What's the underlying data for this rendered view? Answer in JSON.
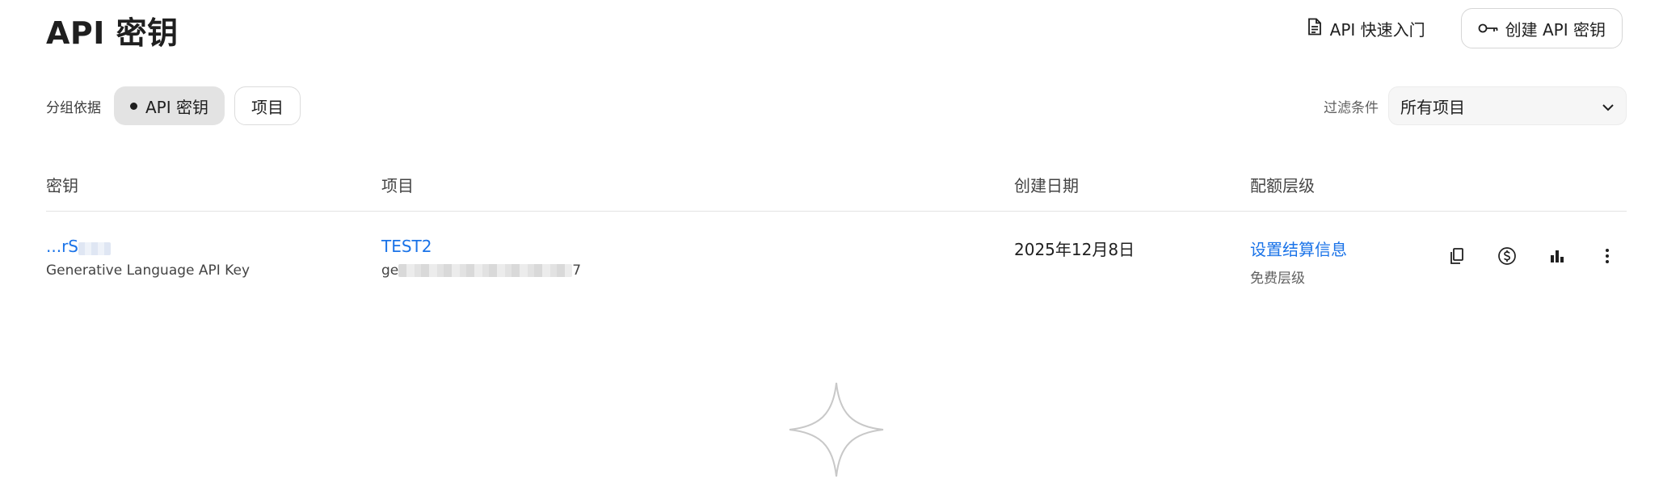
{
  "header": {
    "title": "API 密钥",
    "quickstart_label": "API 快速入门",
    "create_key_label": "创建 API 密钥"
  },
  "groupby": {
    "label": "分组依据",
    "options": [
      {
        "label": "API 密钥",
        "active": true
      },
      {
        "label": "项目",
        "active": false
      }
    ]
  },
  "filter": {
    "label": "过滤条件",
    "selected": "所有项目"
  },
  "table": {
    "columns": [
      "密钥",
      "项目",
      "创建日期",
      "配额层级"
    ],
    "rows": [
      {
        "key_prefix": "...rS",
        "key_description": "Generative Language API Key",
        "project_name": "TEST2",
        "project_id_prefix": "ge",
        "project_id_suffix": "7",
        "created_date": "2025年12月8日",
        "tier_link": "设置结算信息",
        "tier_label": "免费层级"
      }
    ]
  },
  "icons": {
    "quickstart": "document-icon",
    "create": "key-icon",
    "filter_dropdown": "chevron-down-icon",
    "copy": "copy-icon",
    "billing": "dollar-circle-icon",
    "usage": "bar-chart-icon",
    "more": "more-vert-icon",
    "decoration": "sparkle-icon"
  },
  "colors": {
    "link": "#1a73e8",
    "active_chip": "#e3e3e3"
  }
}
